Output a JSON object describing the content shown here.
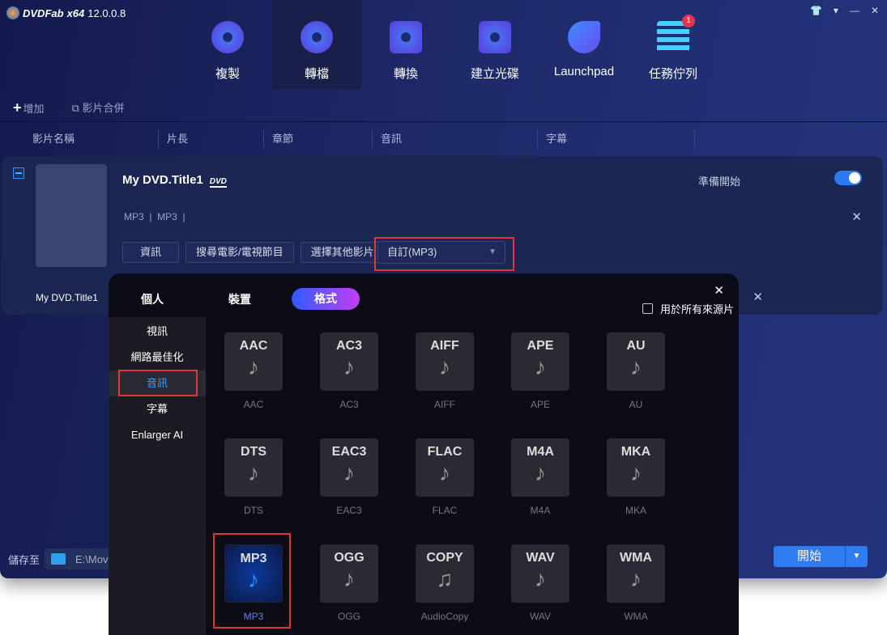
{
  "app": {
    "brand": "DVDFab",
    "arch": "x64",
    "version": "12.0.0.8"
  },
  "window_controls": [
    "skin-icon",
    "menu-icon",
    "minimize-icon",
    "close-icon"
  ],
  "nav": [
    {
      "label": "複製",
      "icon": "disc-copy-icon"
    },
    {
      "label": "轉檔",
      "icon": "disc-ripper-icon",
      "active": true
    },
    {
      "label": "轉換",
      "icon": "video-converter-icon"
    },
    {
      "label": "建立光碟",
      "icon": "disc-creator-icon"
    },
    {
      "label": "Launchpad",
      "icon": "rocket-icon"
    },
    {
      "label": "任務佇列",
      "icon": "task-queue-icon",
      "badge": "1"
    }
  ],
  "toolbar": {
    "add": "增加",
    "merge": "影片合併"
  },
  "columns": [
    "影片名稱",
    "片長",
    "章節",
    "音訊",
    "字幕"
  ],
  "item": {
    "title": "My DVD.Title1",
    "disc_logo": "DVD",
    "audio": "MP3",
    "subtitle": "MP3",
    "buttons": [
      "資訊",
      "搜尋電影/電視節目",
      "選擇其他影片"
    ],
    "profile": "自訂(MP3)",
    "status": "準備開始",
    "enabled": true,
    "row_title": "My DVD.Title1"
  },
  "save": {
    "label": "儲存至",
    "path": "E:\\Movie"
  },
  "start": "開始",
  "popup": {
    "tabs": [
      "個人",
      "裝置",
      "格式"
    ],
    "active_tab": "格式",
    "apply_all": "用於所有來源片",
    "apply_all_checked": false,
    "categories": [
      "視訊",
      "網路最佳化",
      "音訊",
      "字幕",
      "Enlarger AI"
    ],
    "active_category": "音訊",
    "formats": [
      {
        "name": "AAC",
        "label": "AAC"
      },
      {
        "name": "AC3",
        "label": "AC3"
      },
      {
        "name": "AIFF",
        "label": "AIFF"
      },
      {
        "name": "APE",
        "label": "APE"
      },
      {
        "name": "AU",
        "label": "AU"
      },
      {
        "name": "DTS",
        "label": "DTS"
      },
      {
        "name": "EAC3",
        "label": "EAC3"
      },
      {
        "name": "FLAC",
        "label": "FLAC"
      },
      {
        "name": "M4A",
        "label": "M4A"
      },
      {
        "name": "MKA",
        "label": "MKA"
      },
      {
        "name": "MP3",
        "label": "MP3",
        "selected": true
      },
      {
        "name": "OGG",
        "label": "OGG"
      },
      {
        "name": "COPY",
        "label": "AudioCopy"
      },
      {
        "name": "WAV",
        "label": "WAV"
      },
      {
        "name": "WMA",
        "label": "WMA"
      }
    ]
  },
  "colors": {
    "accent": "#2f7cf0",
    "highlight": "#e0343e",
    "selected_text": "#3aa0ff"
  }
}
